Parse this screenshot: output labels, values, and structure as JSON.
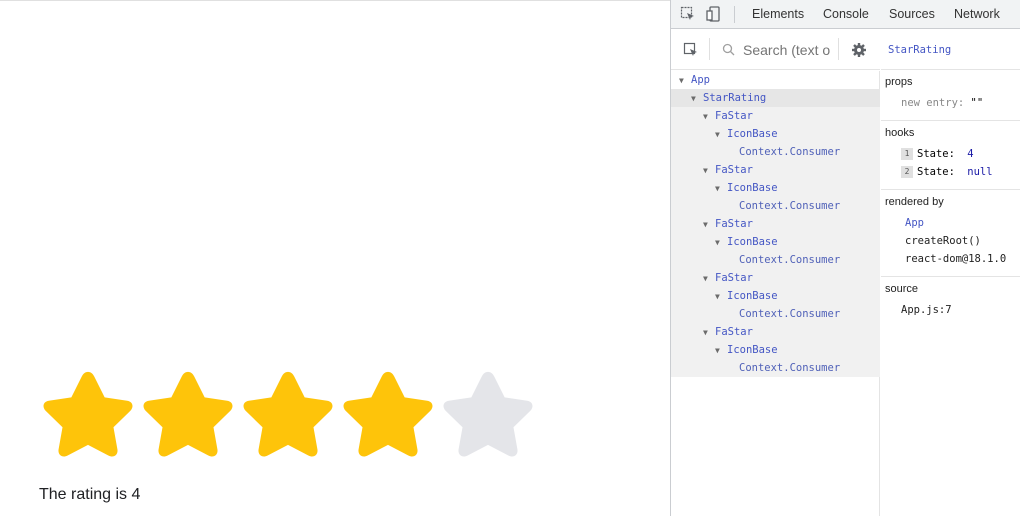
{
  "app": {
    "rating": 4,
    "max_stars": 5,
    "rating_text": "The rating is 4",
    "colors": {
      "filled": "#fec40a",
      "empty": "#e4e5e9"
    }
  },
  "devtools": {
    "tabs": [
      "Elements",
      "Console",
      "Sources",
      "Network"
    ],
    "search_placeholder": "Search (text o",
    "selected_component": "StarRating",
    "tree": [
      {
        "label": "App",
        "depth": 0,
        "expanded": true
      },
      {
        "label": "StarRating",
        "depth": 1,
        "expanded": true,
        "selected": true
      },
      {
        "label": "FaStar",
        "depth": 2,
        "expanded": true
      },
      {
        "label": "IconBase",
        "depth": 3,
        "expanded": true
      },
      {
        "label": "Context.Consumer",
        "depth": 4,
        "expanded": false
      },
      {
        "label": "FaStar",
        "depth": 2,
        "expanded": true
      },
      {
        "label": "IconBase",
        "depth": 3,
        "expanded": true
      },
      {
        "label": "Context.Consumer",
        "depth": 4,
        "expanded": false
      },
      {
        "label": "FaStar",
        "depth": 2,
        "expanded": true
      },
      {
        "label": "IconBase",
        "depth": 3,
        "expanded": true
      },
      {
        "label": "Context.Consumer",
        "depth": 4,
        "expanded": false
      },
      {
        "label": "FaStar",
        "depth": 2,
        "expanded": true
      },
      {
        "label": "IconBase",
        "depth": 3,
        "expanded": true
      },
      {
        "label": "Context.Consumer",
        "depth": 4,
        "expanded": false
      },
      {
        "label": "FaStar",
        "depth": 2,
        "expanded": true
      },
      {
        "label": "IconBase",
        "depth": 3,
        "expanded": true
      },
      {
        "label": "Context.Consumer",
        "depth": 4,
        "expanded": false
      }
    ],
    "props": {
      "title": "props",
      "new_entry_key": "new entry:",
      "new_entry_value": "\"\""
    },
    "hooks": {
      "title": "hooks",
      "items": [
        {
          "index": "1",
          "key": "State:",
          "value": "4"
        },
        {
          "index": "2",
          "key": "State:",
          "value": "null"
        }
      ]
    },
    "rendered_by": {
      "title": "rendered by",
      "items": [
        "App",
        "createRoot()",
        "react-dom@18.1.0"
      ]
    },
    "source": {
      "title": "source",
      "value": "App.js:7"
    }
  }
}
